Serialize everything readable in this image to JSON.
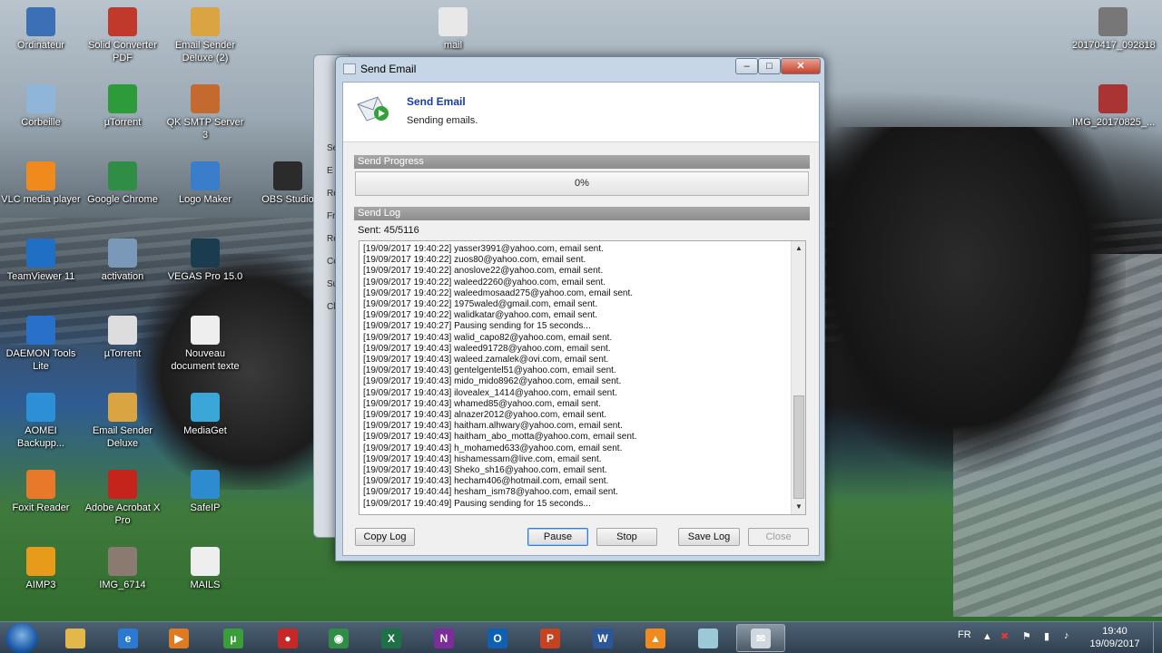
{
  "desktop_icons": [
    {
      "label": "Ordinateur",
      "icon": "computer-icon",
      "color": "#3b6fb6"
    },
    {
      "label": "Solid Converter PDF",
      "icon": "solid-converter-icon",
      "color": "#c0392b"
    },
    {
      "label": "Email Sender Deluxe (2)",
      "icon": "email-sender-icon",
      "color": "#d9a441"
    },
    {
      "label": "mail",
      "icon": "text-file-icon",
      "color": "#e8e8e8"
    },
    {
      "label": "20170417_092818",
      "icon": "image-file-icon",
      "color": "#777777"
    },
    {
      "label": "Corbeille",
      "icon": "recycle-bin-icon",
      "color": "#8fb6d8"
    },
    {
      "label": "µTorrent",
      "icon": "utorrent-icon",
      "color": "#2e9b3a"
    },
    {
      "label": "QK SMTP Server 3",
      "icon": "smtp-server-icon",
      "color": "#c46a2f"
    },
    {
      "label": "IMG_20170825_...",
      "icon": "image-file-icon",
      "color": "#a33"
    },
    {
      "label": "VLC media player",
      "icon": "vlc-icon",
      "color": "#f08a1c"
    },
    {
      "label": "Google Chrome",
      "icon": "chrome-icon",
      "color": "#2f8d46"
    },
    {
      "label": "Logo Maker",
      "icon": "logo-maker-icon",
      "color": "#3a7ecb"
    },
    {
      "label": "OBS Studio",
      "icon": "obs-icon",
      "color": "#2b2b2b"
    },
    {
      "label": "TeamViewer 11",
      "icon": "teamviewer-icon",
      "color": "#1f6fc5"
    },
    {
      "label": "activation",
      "icon": "activation-icon",
      "color": "#7a98b8"
    },
    {
      "label": "VEGAS Pro 15.0",
      "icon": "vegas-icon",
      "color": "#1b3b4f"
    },
    {
      "label": "DAEMON Tools Lite",
      "icon": "daemon-tools-icon",
      "color": "#2870c9"
    },
    {
      "label": "µTorrent",
      "icon": "utorrent-file-icon",
      "color": "#dddddd"
    },
    {
      "label": "Nouveau document texte",
      "icon": "text-file-icon",
      "color": "#eeeeee"
    },
    {
      "label": "AOMEI Backupp...",
      "icon": "aomei-icon",
      "color": "#2d8fd6"
    },
    {
      "label": "Email Sender Deluxe",
      "icon": "email-sender-icon",
      "color": "#d9a441"
    },
    {
      "label": "MediaGet",
      "icon": "mediaget-icon",
      "color": "#3aa7d8"
    },
    {
      "label": "Foxit Reader",
      "icon": "foxit-icon",
      "color": "#e8782a"
    },
    {
      "label": "Adobe Acrobat X Pro",
      "icon": "acrobat-icon",
      "color": "#c4241c"
    },
    {
      "label": "SafeIP",
      "icon": "safeip-icon",
      "color": "#2f8bd0"
    },
    {
      "label": "AIMP3",
      "icon": "aimp-icon",
      "color": "#e89a1a"
    },
    {
      "label": "IMG_6714",
      "icon": "image-file-icon",
      "color": "#8a7a70"
    },
    {
      "label": "MAILS",
      "icon": "text-file-icon",
      "color": "#eeeeee"
    }
  ],
  "background_dialog": {
    "letters": [
      "Se",
      "E",
      "Re",
      "Fr",
      "Re",
      "Cc",
      "Su",
      "Cl"
    ]
  },
  "window": {
    "title": "Send Email",
    "min_glyph": "–",
    "max_glyph": "□",
    "close_glyph": "✕",
    "header_title": "Send Email",
    "header_subtitle": "Sending emails.",
    "progress_section": "Send Progress",
    "progress_text": "0%",
    "progress_value": 0,
    "log_section": "Send Log",
    "sent_text": "Sent: 45/5116",
    "log_lines": [
      "[19/09/2017 19:40:22] yasser3991@yahoo.com, email sent.",
      "[19/09/2017 19:40:22] zuos80@yahoo.com, email sent.",
      "[19/09/2017 19:40:22] anoslove22@yahoo.com, email sent.",
      "[19/09/2017 19:40:22] waleed2260@yahoo.com, email sent.",
      "[19/09/2017 19:40:22] waleedmosaad275@yahoo.com, email sent.",
      "[19/09/2017 19:40:22] 1975waled@gmail.com, email sent.",
      "[19/09/2017 19:40:22] walidkatar@yahoo.com, email sent.",
      "[19/09/2017 19:40:27] Pausing sending for 15 seconds...",
      "[19/09/2017 19:40:43] walid_capo82@yahoo.com, email sent.",
      "[19/09/2017 19:40:43] waleed91728@yahoo.com, email sent.",
      "[19/09/2017 19:40:43] waleed.zamalek@ovi.com, email sent.",
      "[19/09/2017 19:40:43] gentelgentel51@yahoo.com, email sent.",
      "[19/09/2017 19:40:43] mido_mido8962@yahoo.com, email sent.",
      "[19/09/2017 19:40:43] ilovealex_1414@yahoo.com, email sent.",
      "[19/09/2017 19:40:43] whamed85@yahoo.com, email sent.",
      "[19/09/2017 19:40:43] alnazer2012@yahoo.com, email sent.",
      "[19/09/2017 19:40:43] haitham.alhwary@yahoo.com, email sent.",
      "[19/09/2017 19:40:43] haitham_abo_motta@yahoo.com, email sent.",
      "[19/09/2017 19:40:43] h_mohamed633@yahoo.com, email sent.",
      "[19/09/2017 19:40:43] hishamessam@live.com, email sent.",
      "[19/09/2017 19:40:43] Sheko_sh16@yahoo.com, email sent.",
      "[19/09/2017 19:40:43] hecham406@hotmail.com, email sent.",
      "[19/09/2017 19:40:44] hesham_ism78@yahoo.com, email sent.",
      "[19/09/2017 19:40:49] Pausing sending for 15 seconds..."
    ],
    "buttons": {
      "copy_log": "Copy Log",
      "pause": "Pause",
      "stop": "Stop",
      "save_log": "Save Log",
      "close": "Close"
    }
  },
  "taskbar": {
    "apps": [
      {
        "name": "file-explorer-icon",
        "glyph": "",
        "color": "#e3b84a"
      },
      {
        "name": "internet-explorer-icon",
        "glyph": "e",
        "color": "#2a7bd0"
      },
      {
        "name": "media-player-icon",
        "glyph": "▶",
        "color": "#e07a1f"
      },
      {
        "name": "utorrent-taskbar-icon",
        "glyph": "µ",
        "color": "#3a9d3a"
      },
      {
        "name": "red-app-icon",
        "glyph": "●",
        "color": "#c62828"
      },
      {
        "name": "chrome-taskbar-icon",
        "glyph": "◉",
        "color": "#2f8d46"
      },
      {
        "name": "excel-icon",
        "glyph": "X",
        "color": "#1e7145"
      },
      {
        "name": "onenote-icon",
        "glyph": "N",
        "color": "#7b2d9a"
      },
      {
        "name": "outlook-icon",
        "glyph": "O",
        "color": "#0f5fb4"
      },
      {
        "name": "powerpoint-icon",
        "glyph": "P",
        "color": "#c9421f"
      },
      {
        "name": "word-icon",
        "glyph": "W",
        "color": "#2b579a"
      },
      {
        "name": "vlc-taskbar-icon",
        "glyph": "▲",
        "color": "#f08a1c"
      },
      {
        "name": "app-window-icon",
        "glyph": "",
        "color": "#9cc9d8"
      },
      {
        "name": "email-sender-taskbar-icon",
        "glyph": "✉",
        "color": "#cfd8e0"
      }
    ],
    "language": "FR",
    "time": "19:40",
    "date": "19/09/2017"
  }
}
